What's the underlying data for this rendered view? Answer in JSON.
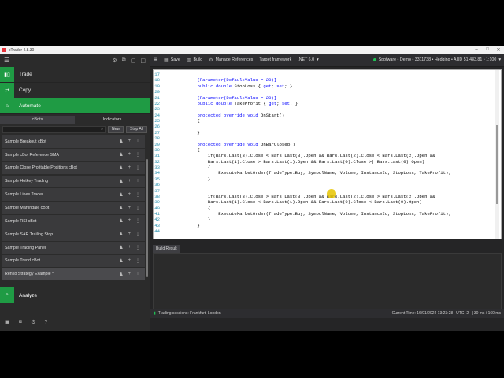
{
  "window": {
    "title": "cTrader 4.8.30"
  },
  "nav": {
    "trade": "Trade",
    "copy": "Copy",
    "automate": "Automate",
    "analyze": "Analyze"
  },
  "subtabs": [
    "cBots",
    "Indicators"
  ],
  "buttons": {
    "new": "New",
    "stop_all": "Stop All"
  },
  "cbots": [
    "Sample Breakout cBot",
    "Sample cBot Reference SMA",
    "Sample Close Profitable Positions cBot",
    "Sample Hotkey Trading",
    "Sample Lines Trader",
    "Sample Martingale cBot",
    "Sample RSI cBot",
    "Sample SAR Trailing Stop",
    "Sample Trading Panel",
    "Sample Trend cBot",
    "Renko Strategy Example *"
  ],
  "toolbar": {
    "save": "Save",
    "build": "Build",
    "manage_refs": "Manage References",
    "target_fw": "Target framework",
    "net": ".NET 6.0",
    "account": "Spotware • Demo • 3311738 • Hedging • AUD 51 483.81 • 1:100"
  },
  "code": [
    {
      "n": "17",
      "t": ""
    },
    {
      "n": "18",
      "t": "    [Parameter(DefaultValue = 20)]"
    },
    {
      "n": "19",
      "t": "    public double StopLoss { get; set; }"
    },
    {
      "n": "20",
      "t": ""
    },
    {
      "n": "21",
      "t": "    [Parameter(DefaultValue = 20)]"
    },
    {
      "n": "22",
      "t": "    public double TakeProfit { get; set; }"
    },
    {
      "n": "23",
      "t": ""
    },
    {
      "n": "24",
      "t": "    protected override void OnStart()"
    },
    {
      "n": "25",
      "t": "    {"
    },
    {
      "n": "26",
      "t": ""
    },
    {
      "n": "27",
      "t": "    }"
    },
    {
      "n": "28",
      "t": ""
    },
    {
      "n": "29",
      "t": "    protected override void OnBarClosed()"
    },
    {
      "n": "30",
      "t": "    {"
    },
    {
      "n": "31",
      "t": "        if(Bars.Last(3).Close < Bars.Last(3).Open && Bars.Last(2).Close < Bars.Last(2).Open &&"
    },
    {
      "n": "32",
      "t": "        Bars.Last(1).Close > Bars.Last(1).Open && Bars.Last(0).Close >| Bars.Last(0).Open)"
    },
    {
      "n": "33",
      "t": "        {"
    },
    {
      "n": "34",
      "t": "            ExecuteMarketOrder(TradeType.Buy, SymbolName, Volume, InstanceId, StopLoss, TakeProfit);"
    },
    {
      "n": "35",
      "t": "        }"
    },
    {
      "n": "36",
      "t": ""
    },
    {
      "n": "37",
      "t": ""
    },
    {
      "n": "38",
      "t": "        if(Bars.Last(3).Close > Bars.Last(3).Open && Bars.Last(2).Close > Bars.Last(2).Open &&"
    },
    {
      "n": "39",
      "t": "        Bars.Last(1).Close < Bars.Last(1).Open && Bars.Last(0).Close < Bars.Last(0).Open)"
    },
    {
      "n": "40",
      "t": "        {"
    },
    {
      "n": "41",
      "t": "            ExecuteMarketOrder(TradeType.Buy, SymbolName, Volume, InstanceId, StopLoss, TakeProfit);"
    },
    {
      "n": "42",
      "t": "        }"
    },
    {
      "n": "43",
      "t": "    }"
    },
    {
      "n": "44",
      "t": ""
    }
  ],
  "build_result": {
    "tab": "Build Result"
  },
  "status": {
    "sessions": "Trading sessions: Frankfurt, London",
    "time": "Current Time: 16/01/2024 13:23:28",
    "tz": "UTC+2",
    "latency": "| 30 ms / 160 ms"
  },
  "colors": {
    "accent": "#1f9b44",
    "editor_bg": "#ffffff",
    "keyword": "#0000ff"
  }
}
